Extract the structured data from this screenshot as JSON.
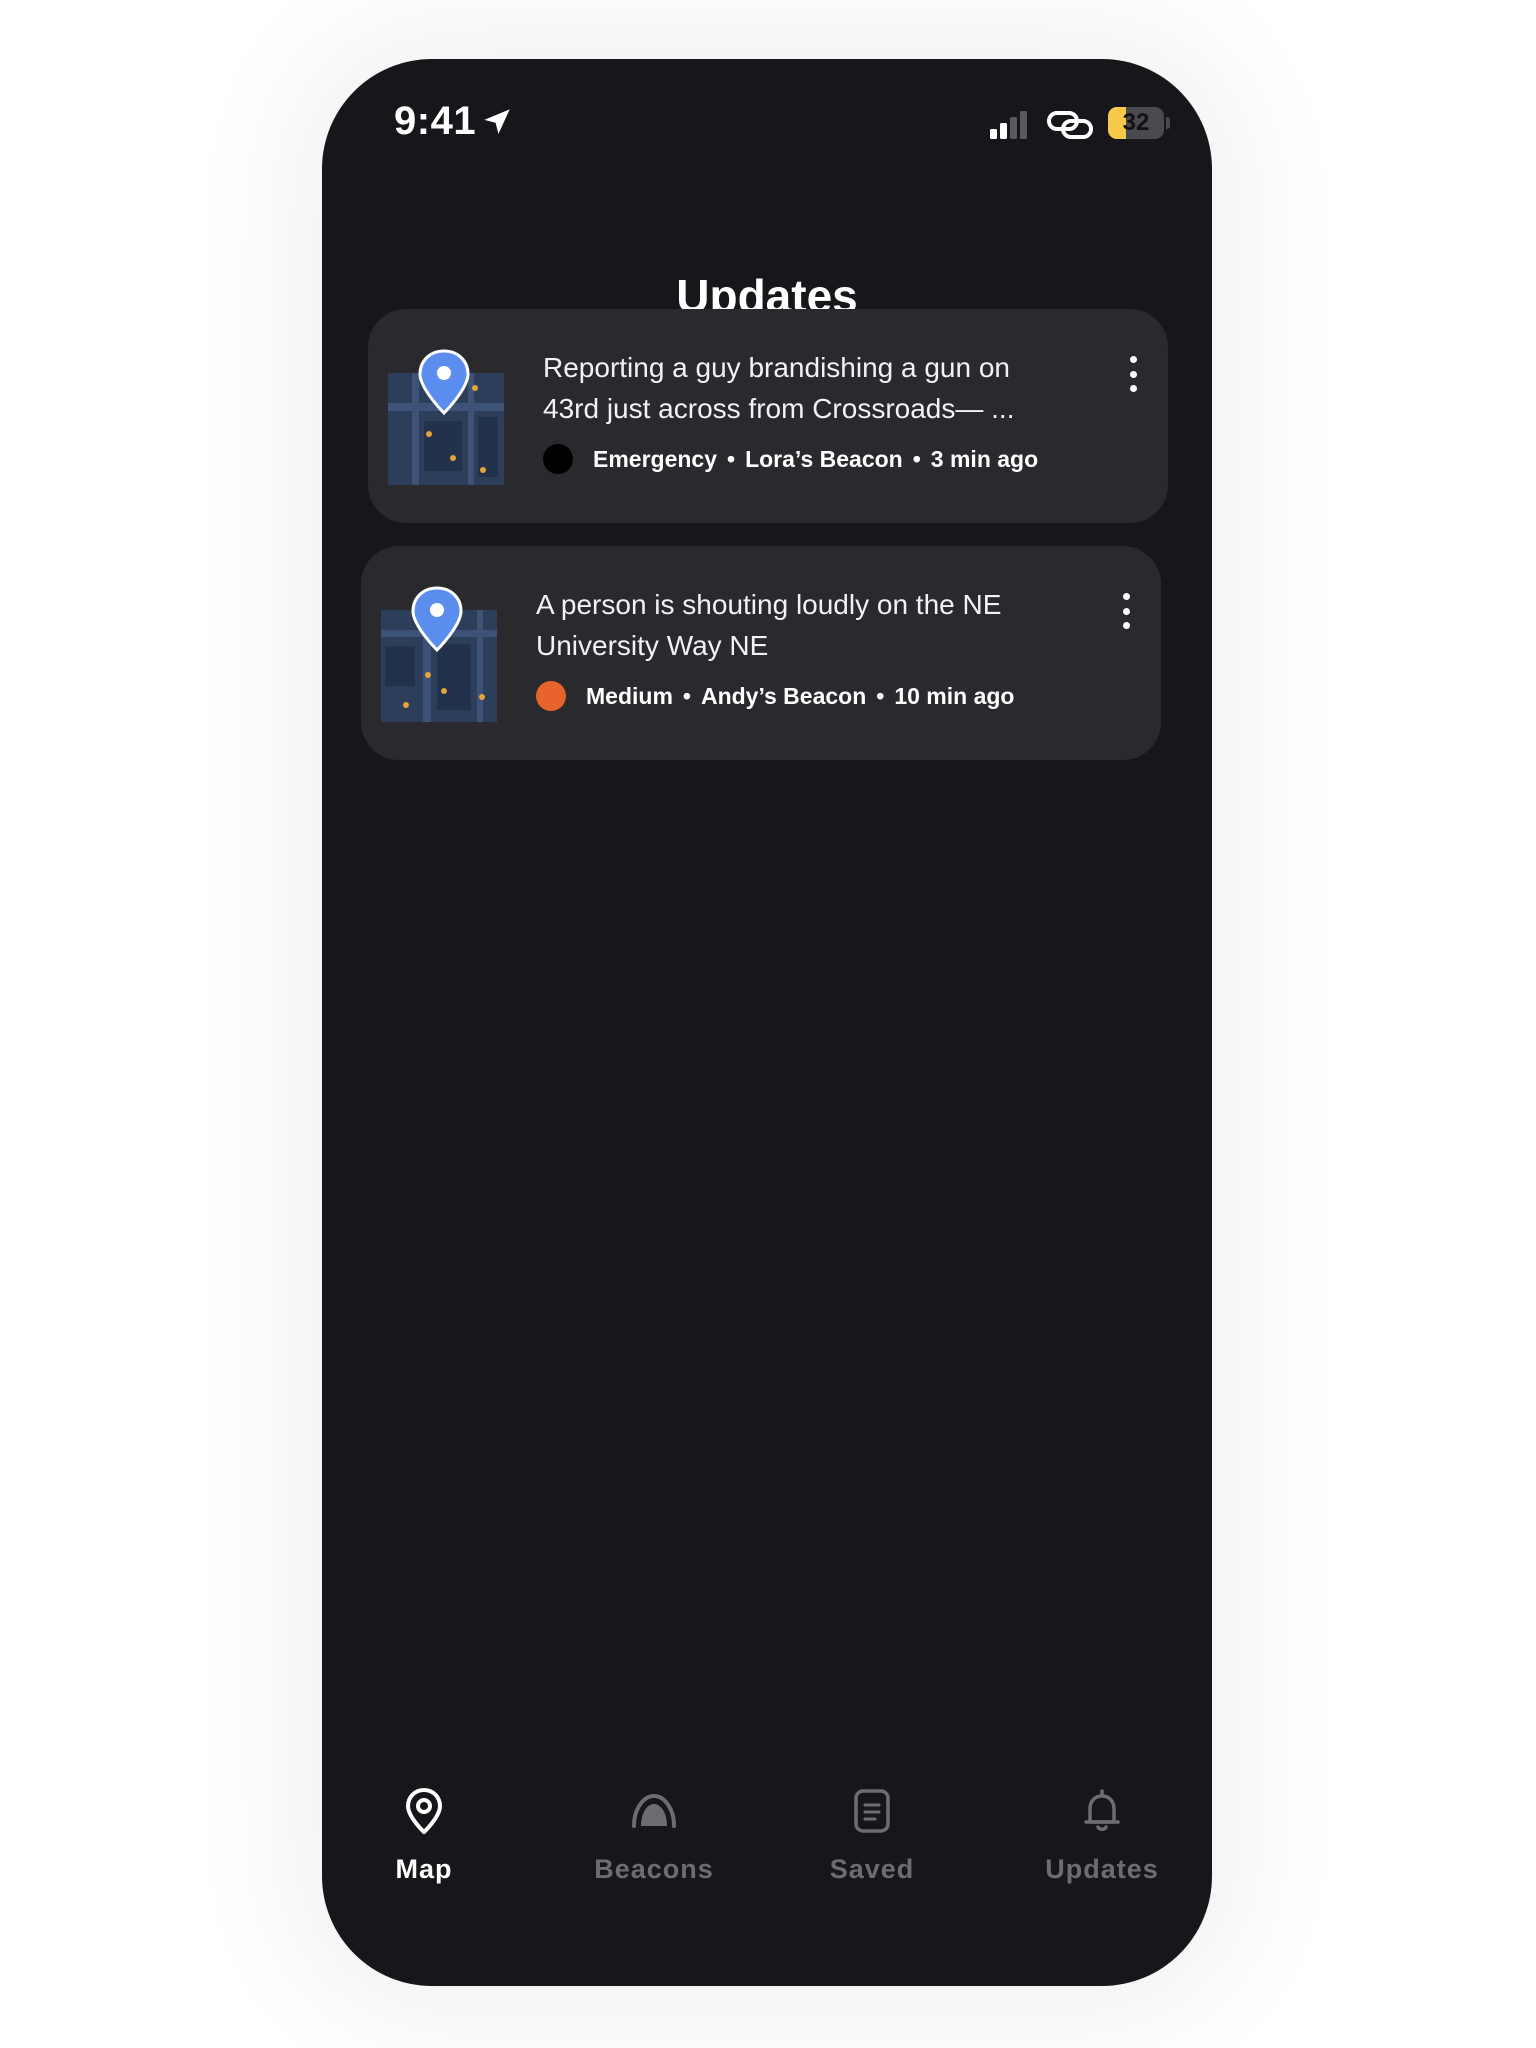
{
  "status_bar": {
    "time": "9:41",
    "battery_level": "32",
    "battery_fraction": 0.32
  },
  "header": {
    "title": "Updates"
  },
  "updates": [
    {
      "text": "Reporting a guy brandishing a gun on 43rd just across from Crossroads— ...",
      "severity": "Emergency",
      "severity_color": "#000000",
      "beacon": "Lora’s Beacon",
      "time_ago": "3 min ago",
      "separator": "•"
    },
    {
      "text": "A person is shouting loudly on the NE University Way NE",
      "severity": "Medium",
      "severity_color": "#e8642c",
      "beacon": "Andy’s Beacon",
      "time_ago": "10 min ago",
      "separator": "•"
    }
  ],
  "tabs": [
    {
      "label": "Map",
      "icon": "map-pin-icon",
      "active": true
    },
    {
      "label": "Beacons",
      "icon": "beacon-dome-icon",
      "active": false
    },
    {
      "label": "Saved",
      "icon": "saved-document-icon",
      "active": false
    },
    {
      "label": "Updates",
      "icon": "bell-icon",
      "active": false
    }
  ],
  "colors": {
    "background": "#17171b",
    "card": "#29292e",
    "tab_active": "#ffffff",
    "tab_inactive": "#6c6c72",
    "pin": "#5b8def"
  }
}
